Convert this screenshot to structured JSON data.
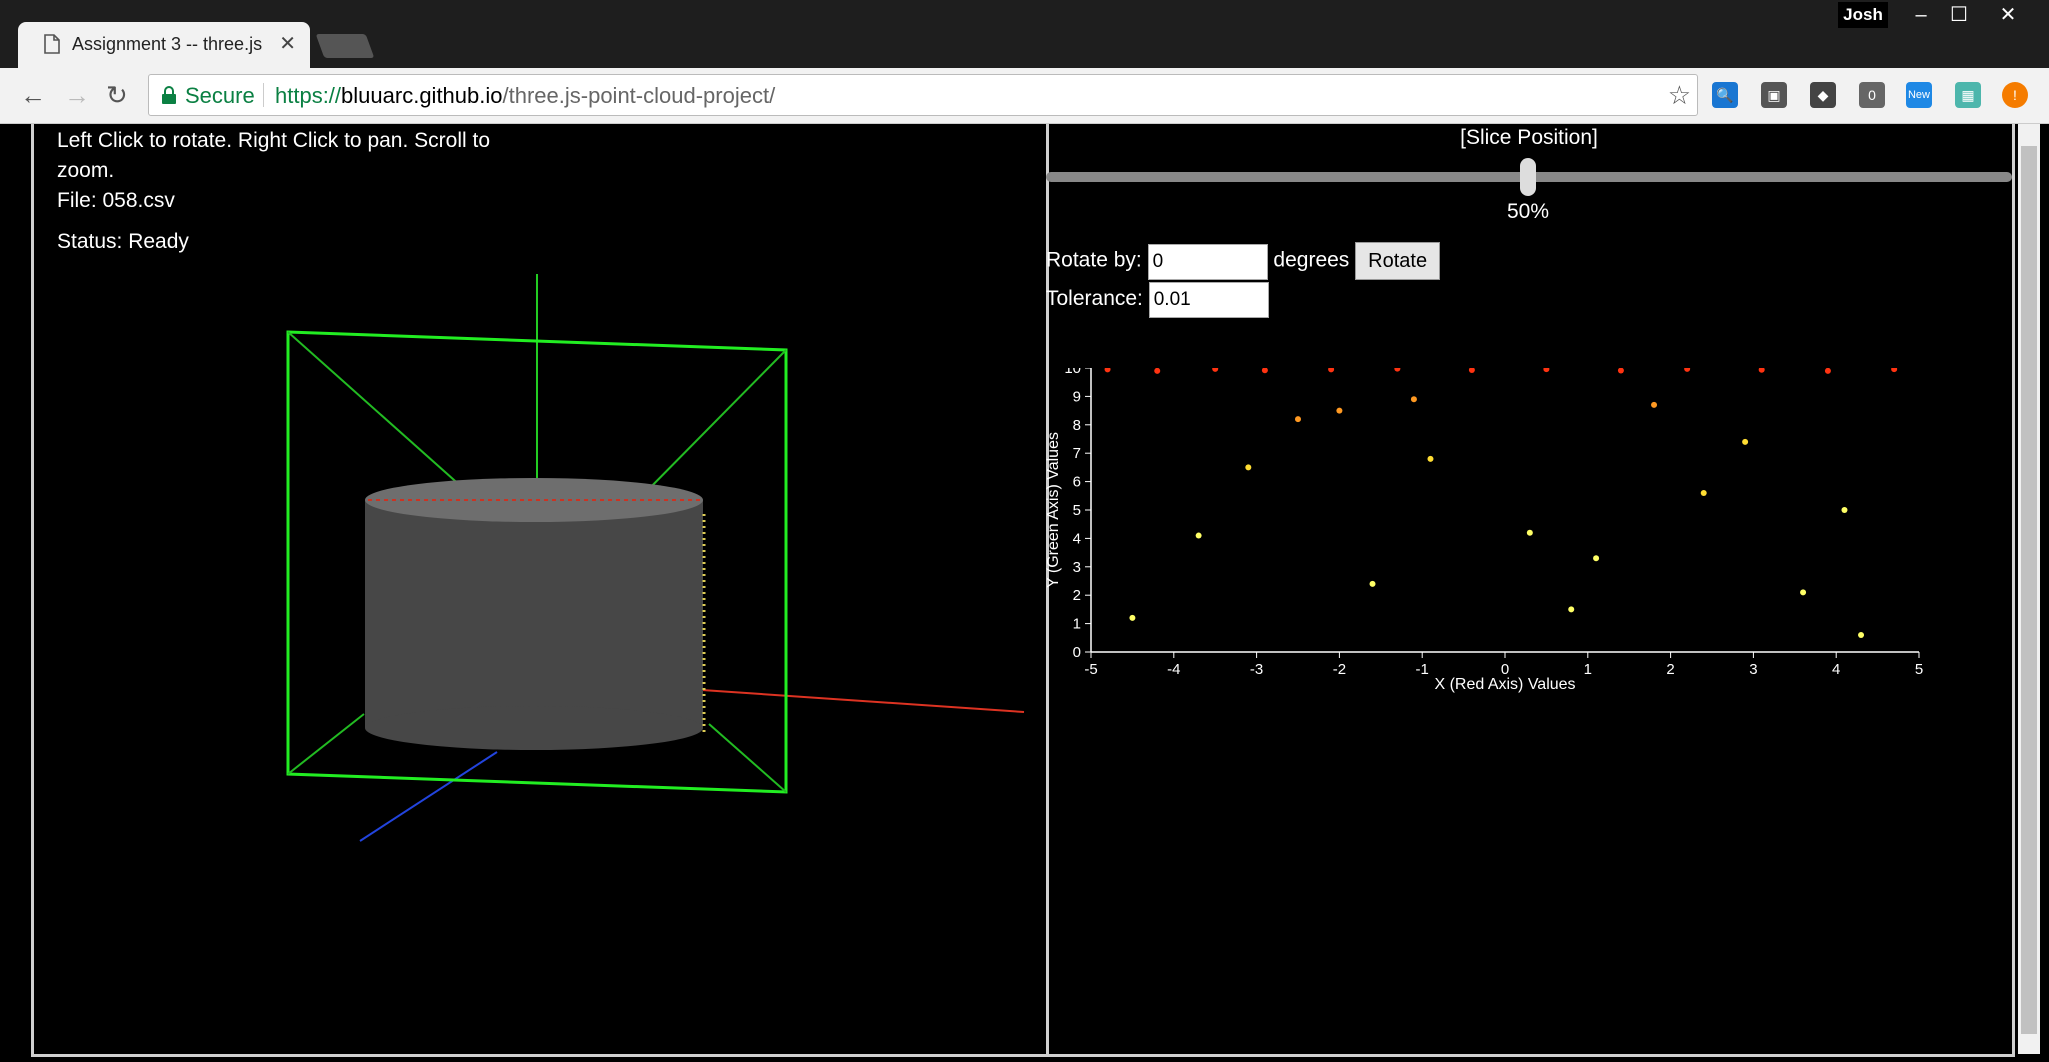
{
  "browser": {
    "tab_title": "Assignment 3 -- three.js",
    "profile": "Josh",
    "security_label": "Secure",
    "url_scheme": "https://",
    "url_host": "bluuarc.github.io",
    "url_path": "/three.js-point-cloud-project/",
    "extension_badge": "0",
    "extension_new": "New"
  },
  "viewer": {
    "instructions": "Left Click to rotate. Right Click to pan. Scroll to zoom.",
    "file_label": "File: 058.csv",
    "status_label": "Status: Ready"
  },
  "slice": {
    "title": "[Slice Position]",
    "position_percent": 50,
    "position_text": "50%",
    "rotate_label": "Rotate by:",
    "rotate_value": "0",
    "degrees_label": "degrees",
    "rotate_button": "Rotate",
    "tolerance_label": "Tolerance:",
    "tolerance_value": "0.01"
  },
  "chart_data": {
    "type": "scatter",
    "xlabel": "X (Red Axis) Values",
    "ylabel": "Y (Green Axis) Values",
    "xlim": [
      -5,
      5
    ],
    "ylim": [
      0,
      10
    ],
    "x_ticks": [
      "-5",
      "-4",
      "-3",
      "-2",
      "-1",
      "0",
      "1",
      "2",
      "3",
      "4",
      "5"
    ],
    "y_ticks": [
      "0",
      "1",
      "2",
      "3",
      "4",
      "5",
      "6",
      "7",
      "8",
      "9",
      "10"
    ],
    "colors": [
      "#ffffcc",
      "#ffff66",
      "#ffdd33",
      "#ff9922",
      "#ff3311"
    ],
    "series": [
      {
        "values": [
          [
            -4.8,
            9.95
          ],
          [
            -4.2,
            9.9
          ],
          [
            -3.5,
            9.97
          ],
          [
            -2.9,
            9.92
          ],
          [
            -2.1,
            9.95
          ],
          [
            -1.3,
            9.98
          ],
          [
            -0.4,
            9.93
          ],
          [
            0.5,
            9.96
          ],
          [
            1.4,
            9.91
          ],
          [
            2.2,
            9.97
          ],
          [
            3.1,
            9.94
          ],
          [
            3.9,
            9.9
          ],
          [
            4.7,
            9.96
          ],
          [
            -2.5,
            8.2
          ],
          [
            -2.0,
            8.5
          ],
          [
            -1.1,
            8.9
          ],
          [
            1.8,
            8.7
          ],
          [
            -3.1,
            6.5
          ],
          [
            0.3,
            4.2
          ],
          [
            2.4,
            5.6
          ],
          [
            3.6,
            2.1
          ],
          [
            -4.5,
            1.2
          ],
          [
            4.3,
            0.6
          ],
          [
            -0.9,
            6.8
          ],
          [
            1.1,
            3.3
          ],
          [
            -1.6,
            2.4
          ],
          [
            2.9,
            7.4
          ],
          [
            0.8,
            1.5
          ],
          [
            -3.7,
            4.1
          ],
          [
            4.1,
            5.0
          ]
        ]
      }
    ]
  }
}
